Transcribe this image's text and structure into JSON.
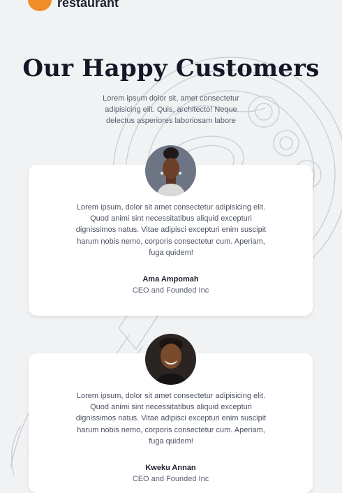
{
  "brand": {
    "name": "restaurant"
  },
  "section": {
    "title": "Our Happy Customers",
    "subtitle": "Lorem ipsum dolor sit, amet consectetur adipisicing elit. Quis, architecto! Neque delectus asperiores laboriosam labore"
  },
  "testimonials": [
    {
      "quote": "Lorem ipsum, dolor sit amet consectetur adipisicing elit. Quod animi sint necessitatibus aliquid excepturi dignissimos natus. Vitae adipisci excepturi enim suscipit harum nobis nemo, corporis consectetur cum. Aperiam, fuga quidem!",
      "name": "Ama Ampomah",
      "role": "CEO and Founded Inc"
    },
    {
      "quote": "Lorem ipsum, dolor sit amet consectetur adipisicing elit. Quod animi sint necessitatibus aliquid excepturi dignissimos natus. Vitae adipisci excepturi enim suscipit harum nobis nemo, corporis consectetur cum. Aperiam, fuga quidem!",
      "name": "Kweku Annan",
      "role": "CEO and Founded Inc"
    }
  ],
  "colors": {
    "accent": "#f28c28",
    "background": "#f1f2f4",
    "card": "#ffffff",
    "heading": "#141826"
  },
  "icons": {
    "logo": "orange-circle-logo",
    "background": "food-plate-sketch"
  }
}
